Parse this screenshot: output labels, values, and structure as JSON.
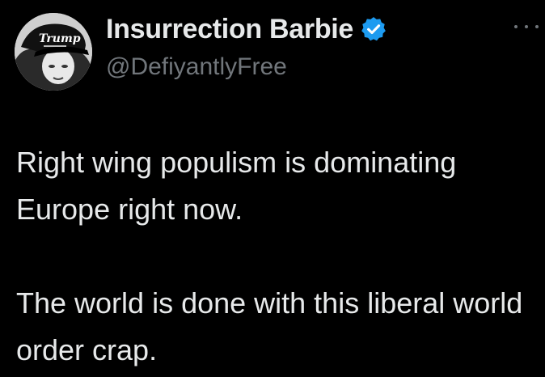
{
  "author": {
    "display_name": "Insurrection Barbie",
    "handle": "@DefiyantlyFree",
    "verified": true,
    "avatar": {
      "icon": "profile-photo",
      "hat_text": "Trump"
    }
  },
  "actions": {
    "more_icon": "more-icon"
  },
  "tweet": {
    "paragraphs": [
      "Right wing populism is dominating Europe right now.",
      "The world is done with this liberal world order crap."
    ]
  },
  "colors": {
    "background": "#000000",
    "text": "#e7e9ea",
    "secondary": "#71767b",
    "verified": "#1d9bf0"
  }
}
